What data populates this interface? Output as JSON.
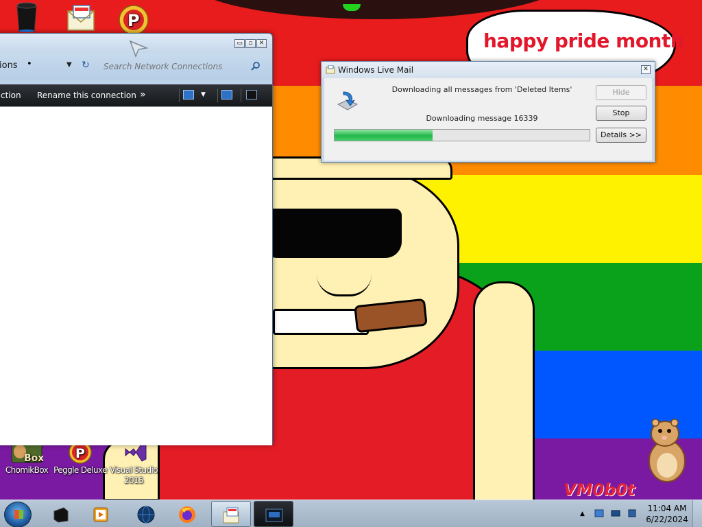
{
  "wallpaper": {
    "speech_text": "happy pride month",
    "watermark_text": "VM0b0t"
  },
  "desktop_icons": [
    {
      "label": "",
      "icon": "recycle-bin-icon"
    },
    {
      "label": "",
      "icon": "windows-live-mail-icon"
    },
    {
      "label": "",
      "icon": "peggle-icon"
    },
    {
      "label": "ChomikBox",
      "icon": "chomikbox-icon"
    },
    {
      "label": "Peggle Deluxe",
      "icon": "peggle-icon"
    },
    {
      "label": "Visual Studio 2015",
      "icon": "visual-studio-icon"
    }
  ],
  "explorer": {
    "breadcrumb_tail": "ions",
    "search_placeholder": "Search Network Connections",
    "commands": {
      "connection_tail": "ction",
      "rename": "Rename this connection",
      "more": "»"
    },
    "buttons": {
      "minimize": "▭",
      "maximize": "▫",
      "close": "✕"
    }
  },
  "live_mail": {
    "title": "Windows Live Mail",
    "status": "Downloading all messages from 'Deleted Items'",
    "message": "Downloading message 16339",
    "progress_fraction": 0.385,
    "buttons": {
      "hide": "Hide",
      "stop": "Stop",
      "details": "Details >>"
    },
    "close": "✕"
  },
  "taskbar": {
    "items": [
      "cmd-icon",
      "media-player-icon",
      "network-globe-icon",
      "firefox-icon",
      "windows-live-mail-icon",
      "console-icon"
    ],
    "clock_time": "11:04 AM",
    "clock_date": "6/22/2024"
  },
  "colors": {
    "speech_text": "#e2172c",
    "progress": "#22b84a",
    "taskbar": "#a6b8cb"
  }
}
